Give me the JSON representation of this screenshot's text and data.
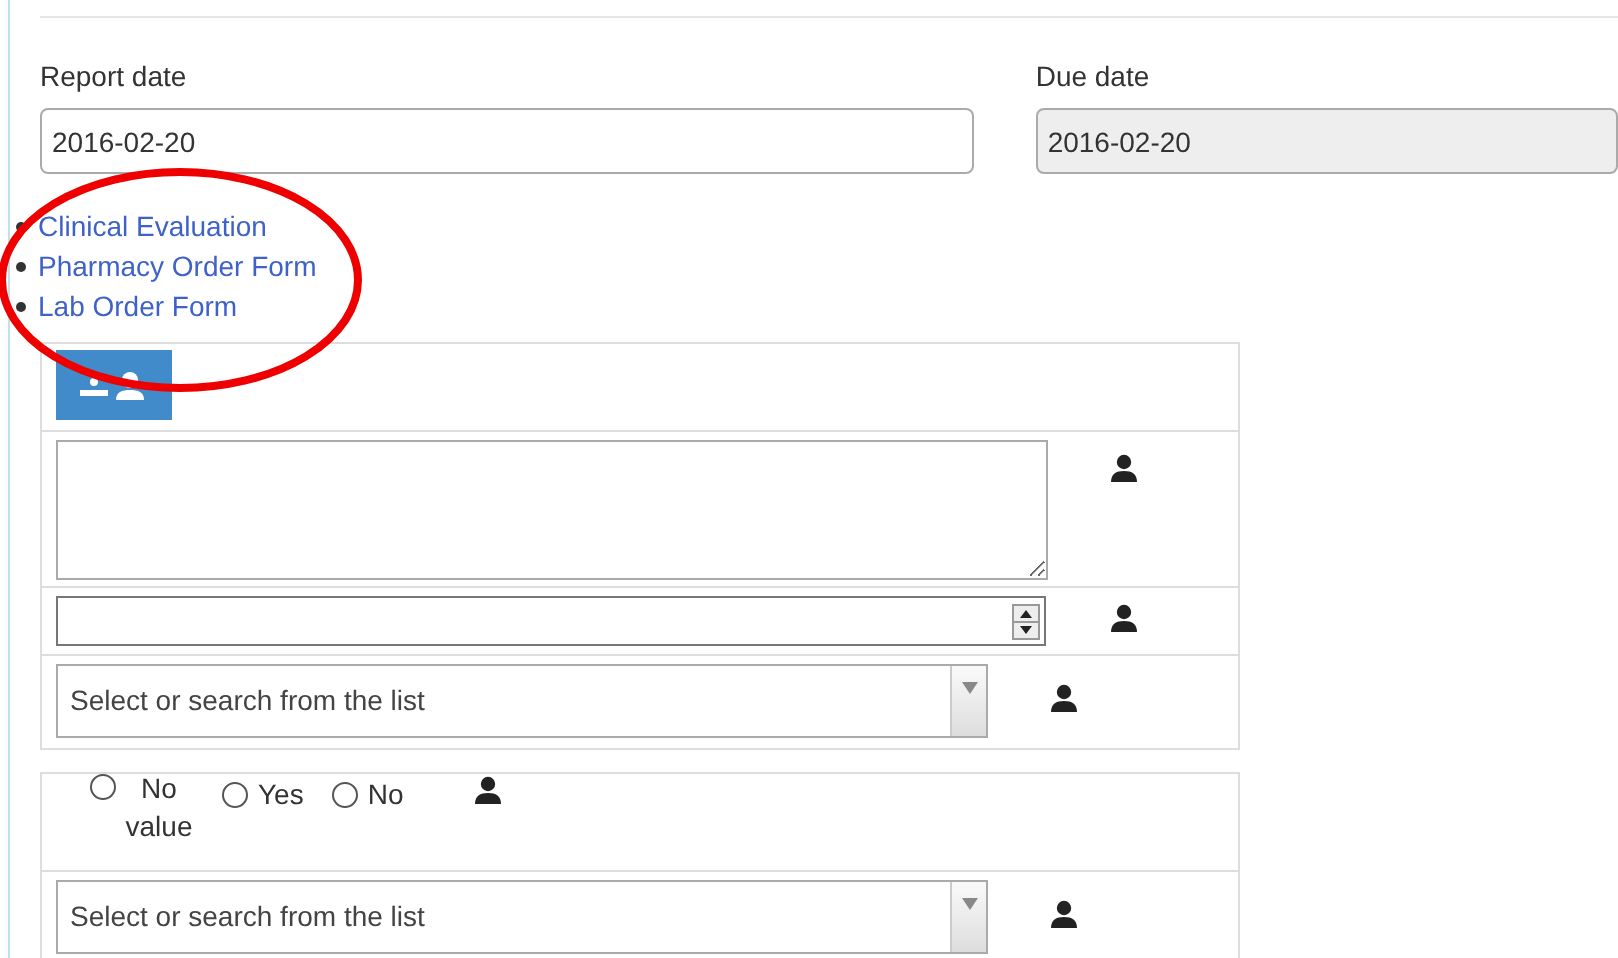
{
  "report_date": {
    "label": "Report date",
    "value": "2016-02-20",
    "disabled": false
  },
  "due_date": {
    "label": "Due date",
    "value": "2016-02-20",
    "disabled": true
  },
  "links": [
    "Clinical Evaluation",
    "Pharmacy Order Form",
    "Lab Order Form"
  ],
  "annotation": {
    "kind": "ellipse"
  },
  "tables": [
    {
      "rows": [
        {
          "kind": "toolbar"
        },
        {
          "kind": "textarea"
        },
        {
          "kind": "number"
        },
        {
          "kind": "select",
          "placeholder": "Select or search from the list"
        }
      ]
    },
    {
      "rows": [
        {
          "kind": "radio",
          "options": [
            {
              "label": "No value",
              "selected": false
            },
            {
              "label": "Yes",
              "selected": false
            },
            {
              "label": "No",
              "selected": false
            }
          ]
        },
        {
          "kind": "select",
          "placeholder": "Select or search from the list"
        }
      ]
    }
  ]
}
